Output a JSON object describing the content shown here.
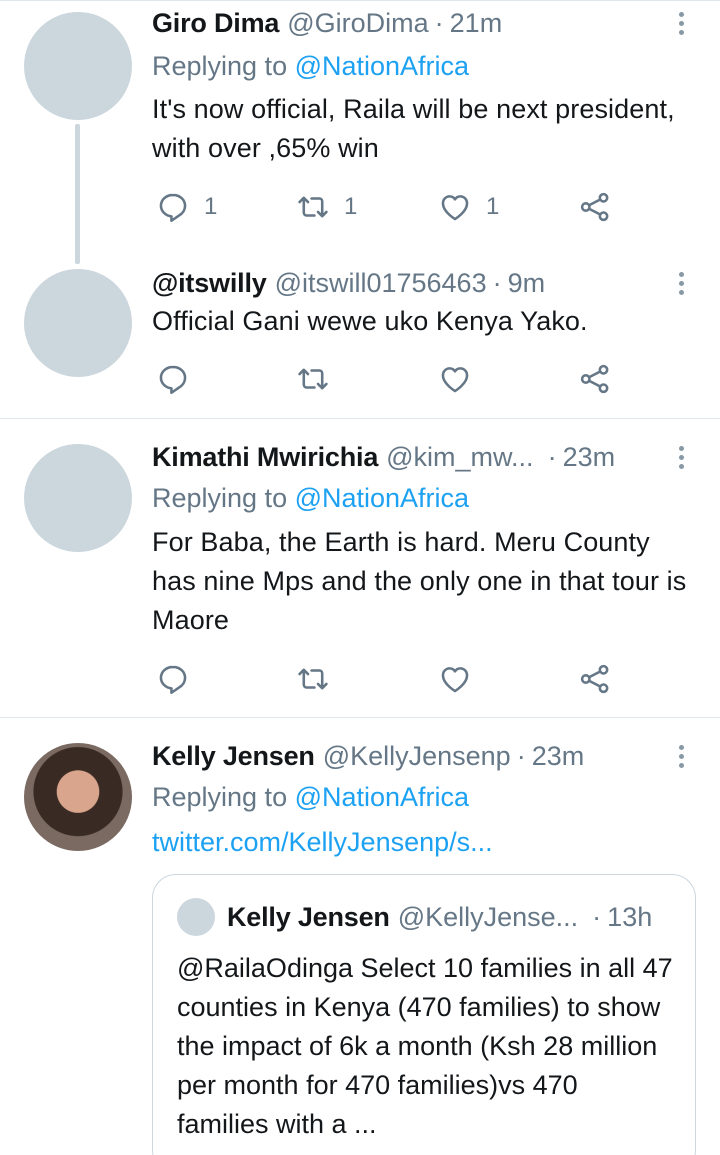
{
  "tweets": [
    {
      "name": "Giro Dima",
      "handle": "@GiroDima",
      "time": "21m",
      "replying_prefix": "Replying to ",
      "replying_to": "@NationAfrica",
      "text": "It's now official, Raila will be next president, with over ,65% win",
      "counts": {
        "replies": "1",
        "retweets": "1",
        "likes": "1"
      }
    },
    {
      "name": "@itswilly",
      "handle": "@itswill01756463",
      "time": "9m",
      "text": "Official Gani wewe uko Kenya Yako."
    },
    {
      "name": "Kimathi Mwirichia",
      "handle": "@kim_mw...",
      "time": "23m",
      "replying_prefix": "Replying to ",
      "replying_to": "@NationAfrica",
      "text": "For Baba, the Earth is hard. Meru County has nine Mps and the only one in that tour is Maore"
    },
    {
      "name": "Kelly Jensen",
      "handle": "@KellyJensenp",
      "time": "23m",
      "replying_prefix": "Replying to ",
      "replying_to": "@NationAfrica",
      "link": "twitter.com/KellyJensenp/s...",
      "quote": {
        "name": "Kelly Jensen",
        "handle": "@KellyJense...",
        "time": "13h",
        "text": "@RailaOdinga  Select 10 families in all 47 counties in Kenya (470 families) to show the impact  of 6k a month (Ksh 28 million per month for 470 families)vs  470 families with a ..."
      }
    }
  ],
  "separator": "·",
  "icons": {
    "reply": "reply-icon",
    "retweet": "retweet-icon",
    "like": "heart-icon",
    "share": "share-icon",
    "more": "more-vertical-icon"
  },
  "colors": {
    "link": "#1da1f2",
    "secondary": "#657786",
    "avatar_placeholder": "#ccd6dd"
  }
}
